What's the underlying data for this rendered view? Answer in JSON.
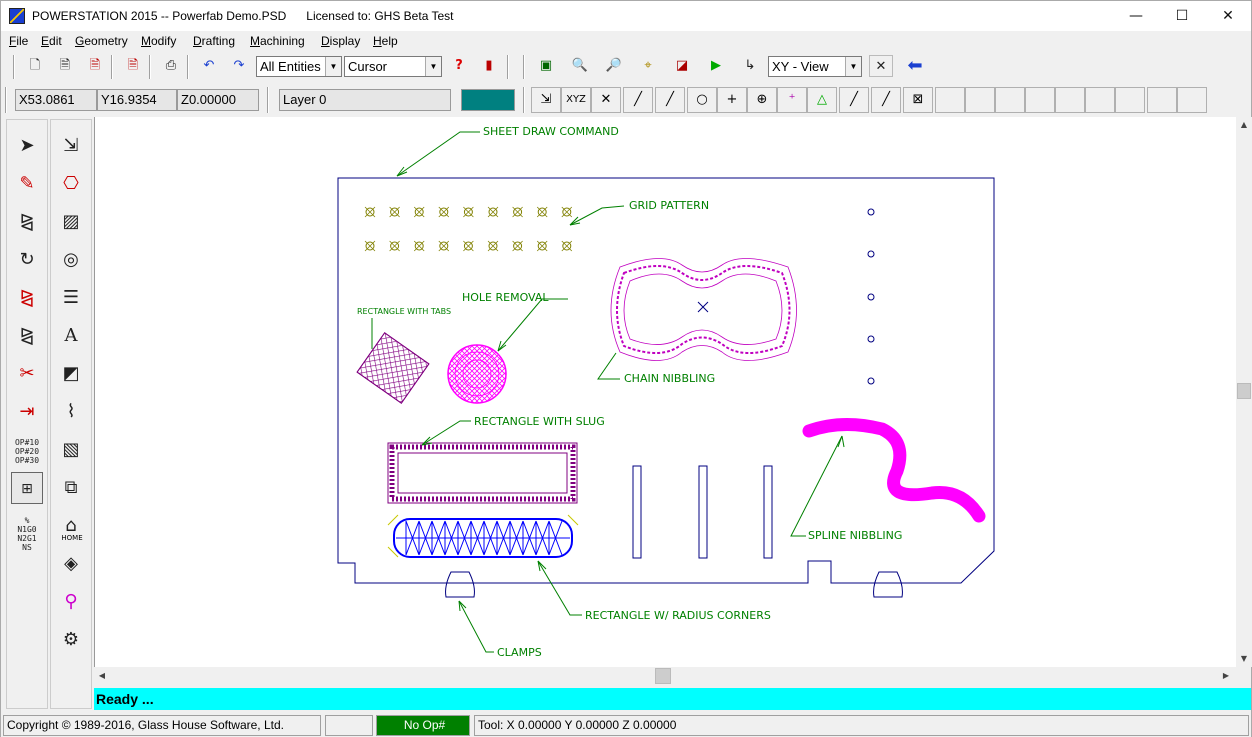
{
  "window": {
    "title": "POWERSTATION 2015 -- Powerfab Demo.PSD      Licensed to: GHS Beta Test",
    "minimize": "—",
    "maximize": "☐",
    "close": "✕"
  },
  "menu": [
    "File",
    "Edit",
    "Geometry",
    "Modify",
    "Drafting",
    "Machining",
    "Display",
    "Help"
  ],
  "toolbar": {
    "entity_filter": "All Entities",
    "cursor_mode": "Cursor",
    "view": "XY - View"
  },
  "coords": {
    "x": "X53.0861",
    "y": "Y16.9354",
    "z": "Z0.00000",
    "layer": "Layer 0",
    "layer_color": "#008080"
  },
  "drawing": {
    "labels": {
      "sheet_draw": "SHEET DRAW COMMAND",
      "grid_pattern": "GRID PATTERN",
      "hole_removal": "HOLE REMOVAL",
      "rect_tabs": "RECTANGLE WITH TABS",
      "chain_nibbling": "CHAIN NIBBLING",
      "rect_slug": "RECTANGLE WITH SLUG",
      "spline_nibbling": "SPLINE NIBBLING",
      "rect_radius": "RECTANGLE W/ RADIUS CORNERS",
      "clamps": "CLAMPS"
    },
    "colors": {
      "annotation": "#008000",
      "sheet": "#000080",
      "magenta": "#ff00ff",
      "purple": "#800080",
      "blue": "#0000ff",
      "olive": "#808000"
    }
  },
  "palette_text": {
    "op_label": "OP#10\nOP#20\nOP#30",
    "home": "HOME"
  },
  "status": {
    "message": "Ready ...",
    "copyright": "Copyright © 1989-2016, Glass House Software, Ltd.",
    "op": "No Op#",
    "op_color": "#008000",
    "tool": "Tool: X 0.00000 Y 0.00000 Z 0.00000"
  }
}
